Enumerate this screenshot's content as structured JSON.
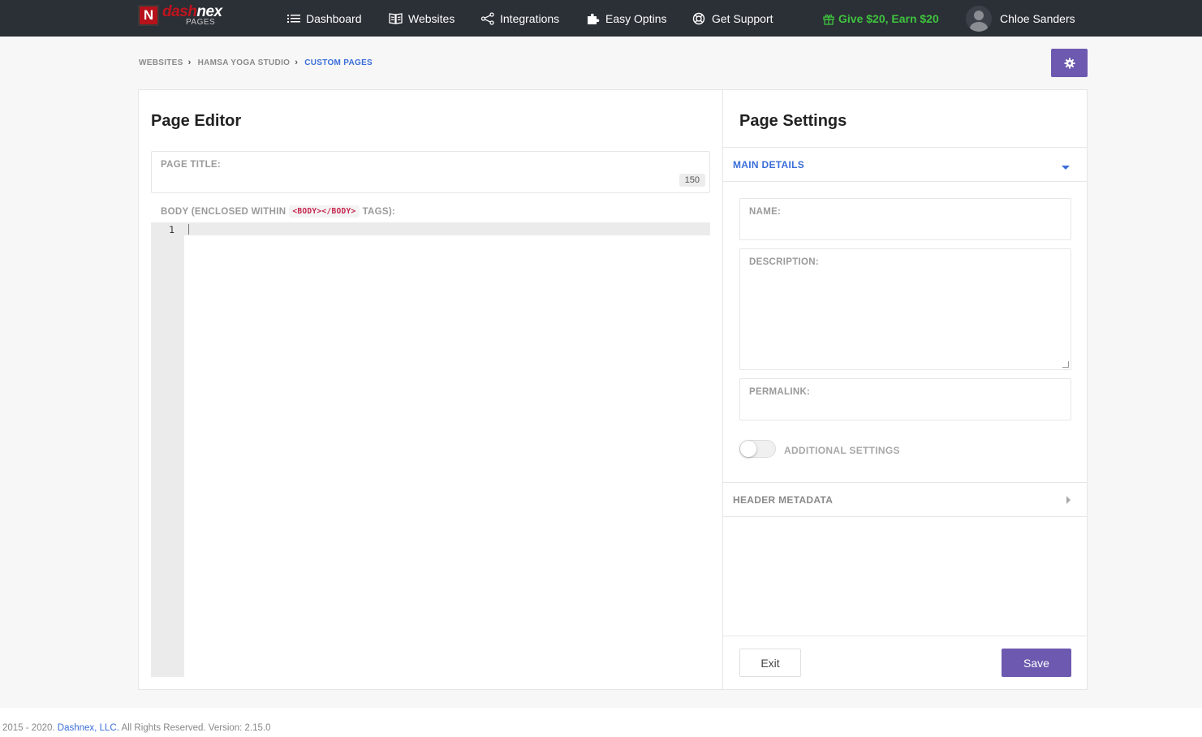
{
  "logo": {
    "word_part1": "dash",
    "word_part2": "nex",
    "sub": "PAGES",
    "badge": "N"
  },
  "nav": {
    "dashboard": "Dashboard",
    "websites": "Websites",
    "integrations": "Integrations",
    "easy_optins": "Easy Optins",
    "get_support": "Get Support",
    "give_earn": "Give $20, Earn $20",
    "user_name": "Chloe Sanders"
  },
  "breadcrumb": {
    "items": [
      "WEBSITES",
      "HAMSA YOGA STUDIO",
      "CUSTOM PAGES"
    ]
  },
  "editor": {
    "title": "Page Editor",
    "page_title_label": "PAGE TITLE:",
    "page_title_value": "",
    "char_counter": "150",
    "body_label_prefix": "BODY (ENCLOSED WITHIN",
    "body_tag": "<BODY></BODY>",
    "body_label_suffix": "TAGS):",
    "line_number": "1"
  },
  "settings": {
    "title": "Page Settings",
    "main_details": "MAIN DETAILS",
    "name_label": "NAME:",
    "description_label": "DESCRIPTION:",
    "permalink_label": "PERMALINK:",
    "additional_settings": "ADDITIONAL SETTINGS",
    "additional_settings_on": false,
    "header_metadata": "HEADER METADATA",
    "exit": "Exit",
    "save": "Save"
  },
  "footer": {
    "prefix": "2015 - 2020.",
    "company": "Dashnex, LLC.",
    "suffix": "All Rights Reserved. Version: 2.15.0"
  },
  "colors": {
    "topbar": "#2b2f36",
    "accent": "#6d59b0",
    "link": "#3a6ed8",
    "promo": "#3ec43e",
    "brand_red": "#c0141c"
  }
}
